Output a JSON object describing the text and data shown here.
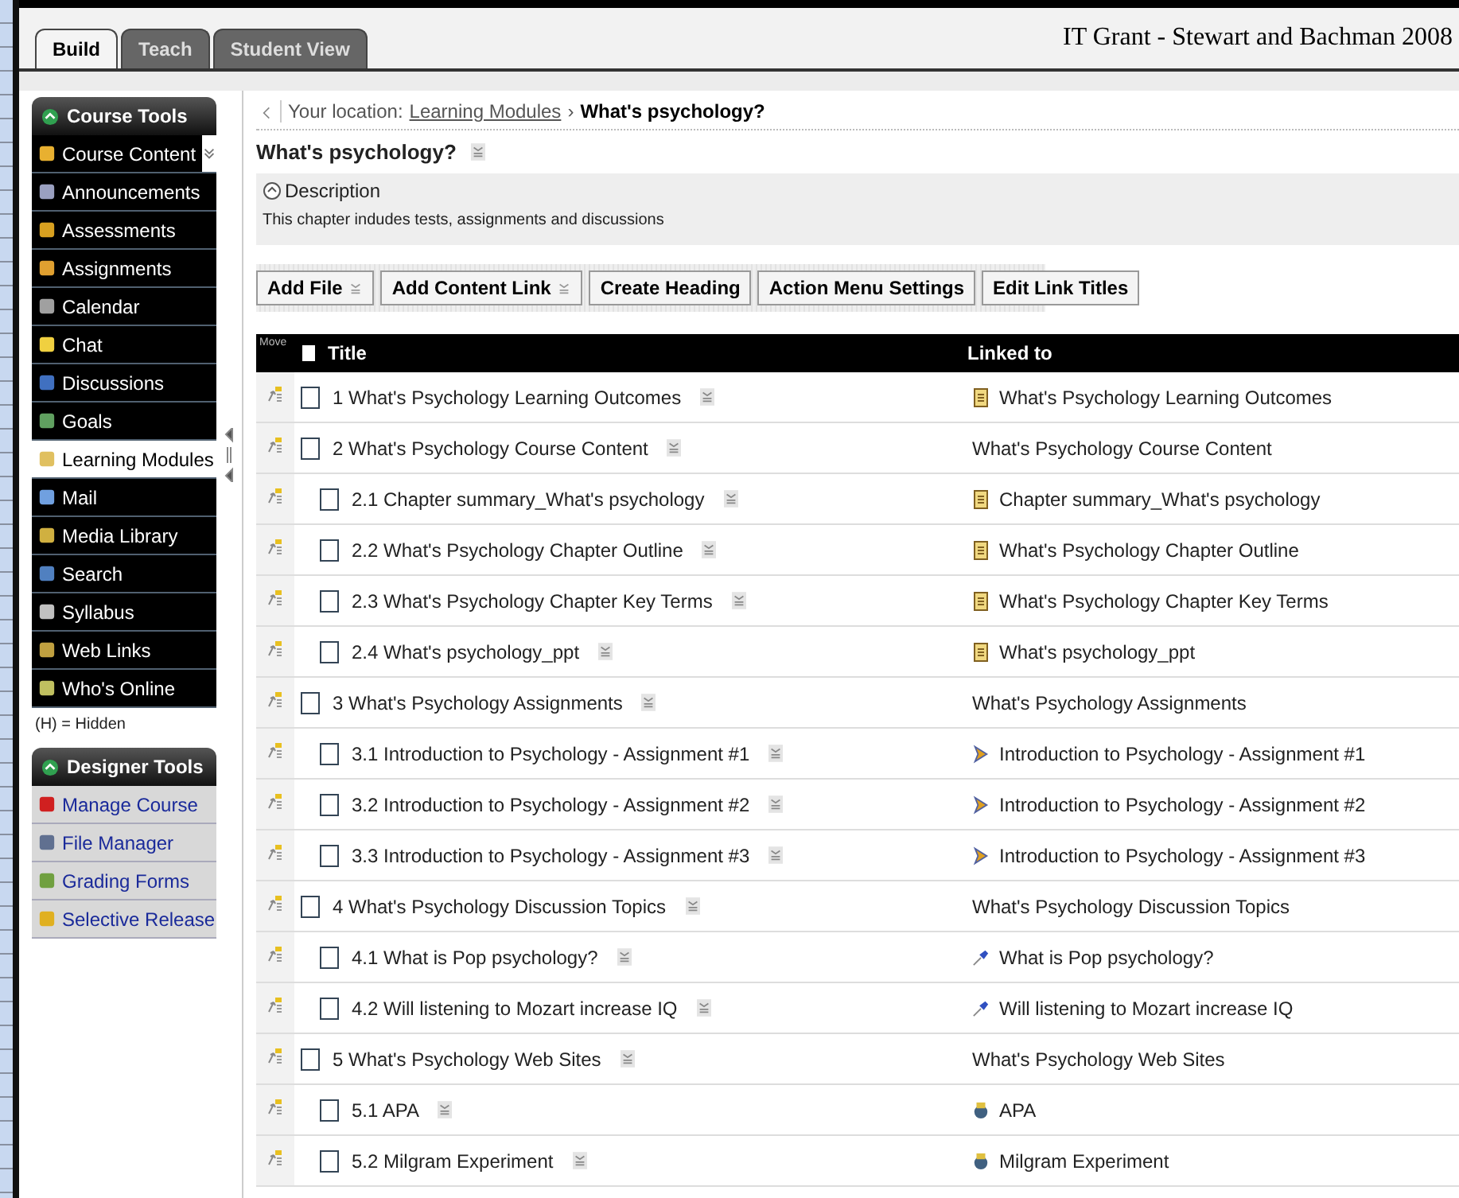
{
  "tabs": [
    {
      "label": "Build",
      "selected": true
    },
    {
      "label": "Teach",
      "selected": false
    },
    {
      "label": "Student View",
      "selected": false
    }
  ],
  "course_title": "IT Grant - Stewart and Bachman 2008",
  "sidebar": {
    "course_tools": {
      "title": "Course Tools",
      "items": [
        {
          "label": "Course Content",
          "selected": false,
          "expandable": true
        },
        {
          "label": "Announcements",
          "selected": false,
          "expandable": false
        },
        {
          "label": "Assessments",
          "selected": false,
          "expandable": false
        },
        {
          "label": "Assignments",
          "selected": false,
          "expandable": false
        },
        {
          "label": "Calendar",
          "selected": false,
          "expandable": false
        },
        {
          "label": "Chat",
          "selected": false,
          "expandable": false
        },
        {
          "label": "Discussions",
          "selected": false,
          "expandable": false
        },
        {
          "label": "Goals",
          "selected": false,
          "expandable": false
        },
        {
          "label": "Learning Modules",
          "selected": true,
          "expandable": false
        },
        {
          "label": "Mail",
          "selected": false,
          "expandable": false
        },
        {
          "label": "Media Library",
          "selected": false,
          "expandable": false
        },
        {
          "label": "Search",
          "selected": false,
          "expandable": false
        },
        {
          "label": "Syllabus",
          "selected": false,
          "expandable": false
        },
        {
          "label": "Web Links",
          "selected": false,
          "expandable": false
        },
        {
          "label": "Who's Online",
          "selected": false,
          "expandable": false
        }
      ]
    },
    "hidden_note": "(H) = Hidden",
    "designer_tools": {
      "title": "Designer Tools",
      "items": [
        {
          "label": "Manage Course"
        },
        {
          "label": "File Manager"
        },
        {
          "label": "Grading Forms"
        },
        {
          "label": "Selective Release"
        }
      ]
    }
  },
  "breadcrumb": {
    "prefix": "Your location:",
    "link": "Learning Modules",
    "separator": "›",
    "current": "What's psychology?"
  },
  "page_title": "What's psychology?",
  "description": {
    "heading": "Description",
    "text": "This chapter indudes tests, assignments and discussions"
  },
  "buttons": [
    {
      "label": "Add File",
      "menu": true
    },
    {
      "label": "Add Content Link",
      "menu": true
    },
    {
      "label": "Create Heading",
      "menu": false
    },
    {
      "label": "Action Menu Settings",
      "menu": false
    },
    {
      "label": "Edit Link Titles",
      "menu": false
    }
  ],
  "table": {
    "select_all_checked": false,
    "columns": {
      "move": "Move",
      "title": "Title",
      "linked": "Linked to"
    },
    "rows": [
      {
        "title": "1 What's Psychology Learning Outcomes",
        "checked": false,
        "linked": "What's Psychology Learning Outcomes",
        "kind": "file"
      },
      {
        "title": "2 What's Psychology Course Content",
        "checked": false,
        "linked": "What's Psychology Course Content",
        "kind": "heading",
        "children": [
          {
            "title": "2.1 Chapter summary_What's psychology",
            "checked": false,
            "linked": "Chapter summary_What's psychology",
            "kind": "file"
          },
          {
            "title": "2.2 What's Psychology Chapter Outline",
            "checked": false,
            "linked": "What's Psychology Chapter Outline",
            "kind": "file"
          },
          {
            "title": "2.3 What's Psychology Chapter Key Terms",
            "checked": false,
            "linked": "What's Psychology Chapter Key Terms",
            "kind": "file"
          },
          {
            "title": "2.4 What's psychology_ppt",
            "checked": false,
            "linked": "What's psychology_ppt",
            "kind": "file"
          }
        ]
      },
      {
        "title": "3 What's Psychology Assignments",
        "checked": false,
        "linked": "What's Psychology Assignments",
        "kind": "heading",
        "children": [
          {
            "title": "3.1 Introduction to Psychology - Assignment #1",
            "checked": false,
            "linked": "Introduction to Psychology - Assignment #1",
            "kind": "assignment"
          },
          {
            "title": "3.2 Introduction to Psychology - Assignment #2",
            "checked": false,
            "linked": "Introduction to Psychology - Assignment #2",
            "kind": "assignment"
          },
          {
            "title": "3.3 Introduction to Psychology - Assignment #3",
            "checked": false,
            "linked": "Introduction to Psychology - Assignment #3",
            "kind": "assignment"
          }
        ]
      },
      {
        "title": "4 What's Psychology Discussion Topics",
        "checked": false,
        "linked": "What's Psychology Discussion Topics",
        "kind": "heading",
        "children": [
          {
            "title": "4.1 What is Pop psychology?",
            "checked": false,
            "linked": "What is Pop psychology?",
            "kind": "discussion"
          },
          {
            "title": "4.2 Will listening to Mozart increase IQ",
            "checked": false,
            "linked": "Will listening to Mozart increase IQ",
            "kind": "discussion"
          }
        ]
      },
      {
        "title": "5 What's Psychology Web Sites",
        "checked": false,
        "linked": "What's Psychology Web Sites",
        "kind": "heading",
        "children": [
          {
            "title": "5.1 APA",
            "checked": false,
            "linked": "APA",
            "kind": "weblink"
          },
          {
            "title": "5.2 Milgram Experiment",
            "checked": false,
            "linked": "Milgram Experiment",
            "kind": "weblink"
          }
        ]
      }
    ]
  }
}
